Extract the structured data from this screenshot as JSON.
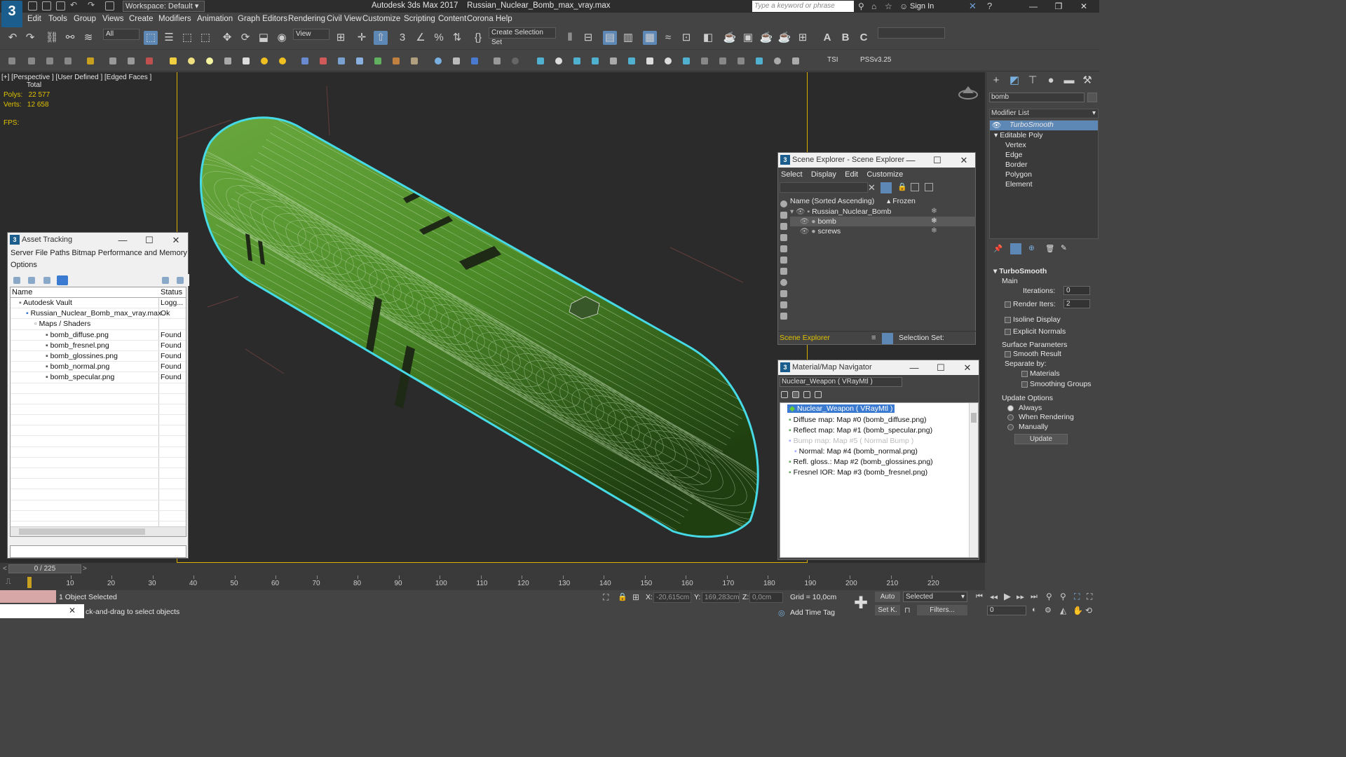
{
  "app": {
    "title": "Autodesk 3ds Max 2017",
    "file": "Russian_Nuclear_Bomb_max_vray.max",
    "logo": "3",
    "workspace": "Workspace: Default",
    "search_placeholder": "Type a keyword or phrase",
    "sign_in": "Sign In"
  },
  "menu": [
    "Edit",
    "Tools",
    "Group",
    "Views",
    "Create",
    "Modifiers",
    "Animation",
    "Graph Editors",
    "Rendering",
    "Civil View",
    "Customize",
    "Scripting",
    "Content",
    "Corona",
    "Help"
  ],
  "toolbar": {
    "filter": "All",
    "ref_coord": "View",
    "selection_set": "Create Selection Set",
    "tsi": "TSI",
    "pss": "PSSv3.25"
  },
  "viewport": {
    "label": "[+] [Perspective ] [User Defined ] [Edged Faces ]",
    "total_label": "Total",
    "polys_label": "Polys:",
    "polys_value": "22 577",
    "verts_label": "Verts:",
    "verts_value": "12 658",
    "fps_label": "FPS:"
  },
  "asset_tracking": {
    "title": "Asset Tracking",
    "menu": "Server   File   Paths   Bitmap Performance and Memory",
    "menu2": "Options",
    "col_name": "Name",
    "col_status": "Status",
    "rows": [
      {
        "name": "Autodesk Vault",
        "status": "Logg..."
      },
      {
        "name": "Russian_Nuclear_Bomb_max_vray.max",
        "status": "Ok"
      },
      {
        "name": "Maps / Shaders",
        "status": ""
      },
      {
        "name": "bomb_diffuse.png",
        "status": "Found"
      },
      {
        "name": "bomb_fresnel.png",
        "status": "Found"
      },
      {
        "name": "bomb_glossines.png",
        "status": "Found"
      },
      {
        "name": "bomb_normal.png",
        "status": "Found"
      },
      {
        "name": "bomb_specular.png",
        "status": "Found"
      }
    ]
  },
  "scene_explorer": {
    "title": "Scene Explorer - Scene Explorer",
    "menu": [
      "Select",
      "Display",
      "Edit",
      "Customize"
    ],
    "col_name": "Name (Sorted Ascending)",
    "col_frozen": "▴ Frozen",
    "items": [
      "Russian_Nuclear_Bomb",
      "bomb",
      "screws"
    ],
    "footer_label": "Scene Explorer",
    "selection_set_label": "Selection Set:"
  },
  "material_navigator": {
    "title": "Material/Map Navigator",
    "current": "Nuclear_Weapon  ( VRayMtl )",
    "root": "Nuclear_Weapon  ( VRayMtl )",
    "maps": [
      "Diffuse map: Map #0 (bomb_diffuse.png)",
      "Reflect map: Map #1 (bomb_specular.png)",
      "Bump map: Map #5  ( Normal Bump )",
      "Normal: Map #4 (bomb_normal.png)",
      "Refl. gloss.: Map #2 (bomb_glossines.png)",
      "Fresnel IOR: Map #3 (bomb_fresnel.png)"
    ]
  },
  "command_panel": {
    "object_name": "bomb",
    "modifier_list": "Modifier List",
    "stack": [
      "TurboSmooth",
      "Editable Poly",
      "Vertex",
      "Edge",
      "Border",
      "Polygon",
      "Element"
    ],
    "rollout": "TurboSmooth",
    "main": "Main",
    "iterations_label": "Iterations:",
    "iterations_value": "0",
    "render_iters_label": "Render Iters:",
    "render_iters_value": "2",
    "isoline": "Isoline Display",
    "explicit_normals": "Explicit Normals",
    "surface_params": "Surface Parameters",
    "smooth_result": "Smooth Result",
    "separate_by": "Separate by:",
    "materials": "Materials",
    "smoothing_groups": "Smoothing Groups",
    "update_options": "Update Options",
    "always": "Always",
    "when_rendering": "When Rendering",
    "manually": "Manually",
    "update_button": "Update"
  },
  "timeline": {
    "frame_counter": "0 / 225",
    "ticks": [
      "10",
      "20",
      "30",
      "40",
      "50",
      "60",
      "70",
      "80",
      "90",
      "100",
      "110",
      "120",
      "130",
      "140",
      "150",
      "160",
      "170",
      "180",
      "190",
      "200",
      "210",
      "220"
    ]
  },
  "status": {
    "selected": "1 Object Selected",
    "prompt": "ck-and-drag to select objects",
    "x_label": "X:",
    "x_value": "-20,615cm",
    "y_label": "Y:",
    "y_value": "169,283cm",
    "z_label": "Z:",
    "z_value": "0,0cm",
    "grid": "Grid = 10,0cm",
    "add_time_tag": "Add Time Tag",
    "auto": "Auto",
    "selected_dropdown": "Selected",
    "setk": "Set K.",
    "filters": "Filters...",
    "frame_field": "0"
  },
  "colors": {
    "bomb_green": "#4f8a2c",
    "selection_outline": "#46d9e6",
    "safe_frame": "#d9b000",
    "selection_highlight": "#5d87b5"
  }
}
